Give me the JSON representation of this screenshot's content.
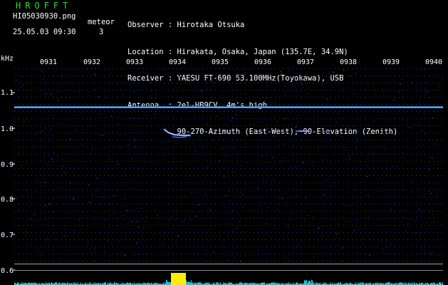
{
  "header": {
    "app_title": "HROFFT",
    "file_name": "HI05030930.png",
    "meteor_label": "meteor",
    "timestamp": "25.05.03 09:30",
    "meteor_count": "3"
  },
  "observer_info": [
    "Observer : Hirotaka Otsuka",
    "Location : Hirakata, Osaka, Japan (135.7E, 34.9N)",
    "Receiver : YAESU FT-690 53.100MHz(Toyokawa), USB",
    "Antenna  : 2el-HB9CV, 4m's high",
    "           90-270-Azimuth (East-West), 90-Elevation (Zenith)"
  ],
  "axis": {
    "y_unit": "kHz",
    "y_ticks": [
      "1.1",
      "1.0",
      "0.9",
      "0.8",
      "0.7",
      "0.6"
    ],
    "x_ticks": [
      "0931",
      "0932",
      "0933",
      "0934",
      "0935",
      "0936",
      "0937",
      "0938",
      "0939",
      "0940"
    ]
  },
  "colors": {
    "title_green": "#28e028",
    "carrier_line": "#7fe07a",
    "meteor_echo": "#8fb4ff",
    "noise_blue": "#1a2fa8",
    "spectrum_cyan": "#19c8d8",
    "spectrum_peak": "#ffee00",
    "grid_blue": "#3a48c8"
  }
}
